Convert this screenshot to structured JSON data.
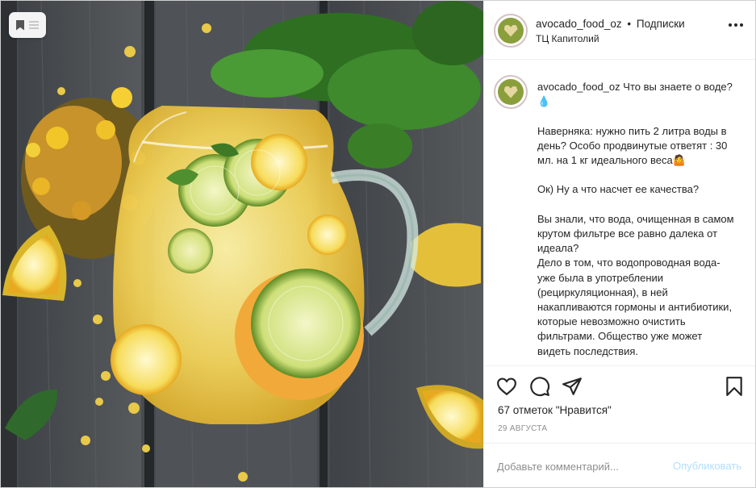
{
  "post": {
    "username": "avocado_food_oz",
    "separator": "•",
    "follow_label": "Подписки",
    "location": "ТЦ Капитолий",
    "caption": "Что вы знаете о воде?💧\n\nНаверняка: нужно пить 2 литра воды в день? Особо продвинутые ответят : 30 мл. на 1 кг идеального веса🤷\n\nОк) Ну а что насчет ее качества?\n\nВы знали, что вода, очищенная в самом крутом фильтре все равно далека от идеала?\nДело в том, что водопроводная вода-уже была в употреблении (рециркуляционная), в ней накапливаются гормоны и антибиотики, которые невозможно очистить фильтрами. Общество уже может видеть последствия.",
    "likes": "67 отметок \"Нравится\"",
    "date": "29 АВГУСТА"
  },
  "comment": {
    "placeholder": "Добавьте комментарий...",
    "publish_label": "Опубликовать"
  },
  "icons": {
    "save_chip": "bookmark-icon",
    "more": "more-options-icon",
    "like": "heart-icon",
    "comment": "comment-icon",
    "share": "share-icon",
    "save": "bookmark-icon"
  },
  "colors": {
    "text": "#262626",
    "muted": "#8e8e8e",
    "publish_disabled": "#b2dffc",
    "divider": "#efefef"
  }
}
